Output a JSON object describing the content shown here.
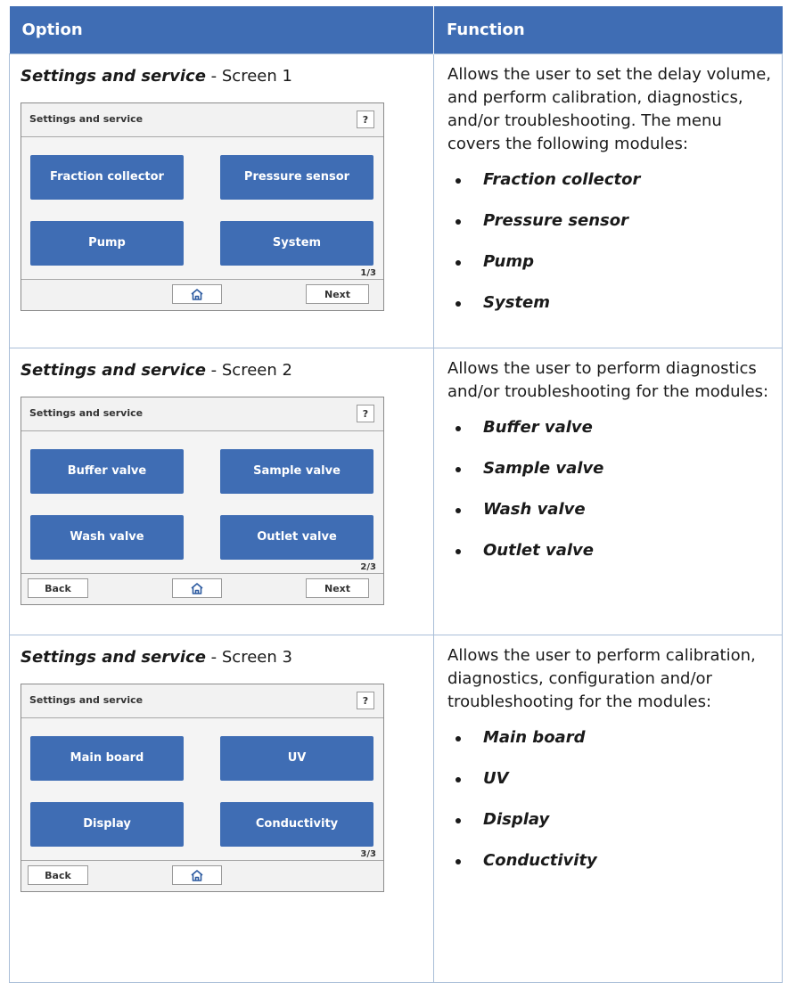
{
  "table": {
    "header": {
      "option": "Option",
      "function": "Function"
    },
    "rows": [
      {
        "option_bold": "Settings and service",
        "option_rest": " - Screen 1",
        "screen": {
          "title": "Settings and service",
          "help": "?",
          "tiles": [
            "Fraction collector",
            "Pressure sensor",
            "Pump",
            "System"
          ],
          "pager": "1/3",
          "back": "",
          "next": "Next"
        },
        "description": "Allows the user to set the delay volume, and perform calibration, diagnostics, and/or troubleshooting. The menu covers the following modules:",
        "modules": [
          "Fraction collector",
          "Pressure sensor",
          "Pump",
          "System"
        ]
      },
      {
        "option_bold": "Settings and service",
        "option_rest": " - Screen 2",
        "screen": {
          "title": "Settings and service",
          "help": "?",
          "tiles": [
            "Buffer valve",
            "Sample valve",
            "Wash valve",
            "Outlet valve"
          ],
          "pager": "2/3",
          "back": "Back",
          "next": "Next"
        },
        "description": "Allows the user to perform diagnostics and/or troubleshooting for the modules:",
        "modules": [
          "Buffer valve",
          "Sample valve",
          "Wash valve",
          "Outlet valve"
        ]
      },
      {
        "option_bold": "Settings and service",
        "option_rest": " - Screen 3",
        "screen": {
          "title": "Settings and service",
          "help": "?",
          "tiles": [
            "Main board",
            "UV",
            "Display",
            "Conductivity"
          ],
          "pager": "3/3",
          "back": "Back",
          "next": ""
        },
        "description": "Allows the user to perform calibration, diagnostics, configuration and/or troubleshooting for the modules:",
        "modules": [
          "Main board",
          "UV",
          "Display",
          "Conductivity"
        ]
      }
    ]
  }
}
